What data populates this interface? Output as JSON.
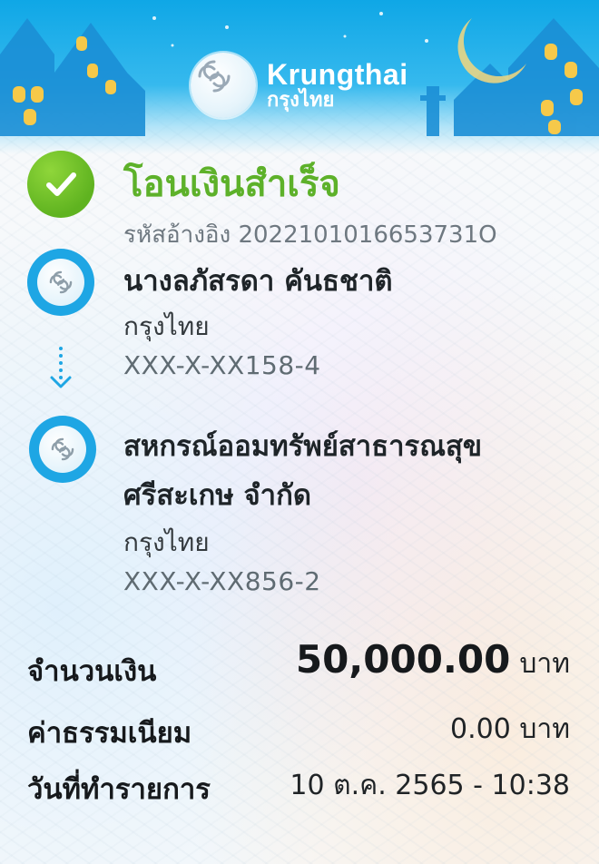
{
  "brand": {
    "name_en": "Krungthai",
    "name_th": "กรุงไทย"
  },
  "status": {
    "title": "โอนเงินสำเร็จ",
    "reference_label": "รหัสอ้างอิง",
    "reference_code": "2022101016653731O"
  },
  "sender": {
    "name": "นางลภัสรดา คันธชาติ",
    "bank": "กรุงไทย",
    "account": "XXX-X-XX158-4"
  },
  "recipient": {
    "name_line1": "สหกรณ์ออมทรัพย์สาธารณสุข",
    "name_line2": "ศรีสะเกษ จำกัด",
    "bank": "กรุงไทย",
    "account": "XXX-X-XX856-2"
  },
  "details": {
    "amount_label": "จำนวนเงิน",
    "amount_value": "50,000.00",
    "amount_unit": "บาท",
    "fee_label": "ค่าธรรมเนียม",
    "fee_value": "0.00 บาท",
    "date_label": "วันที่ทำรายการ",
    "date_value": "10 ต.ค. 2565 - 10:38"
  },
  "colors": {
    "brand_blue": "#1ea6e4",
    "success_green": "#5db12a"
  },
  "icons": {
    "status": "check-circle-icon",
    "bank": "krungthai-logo-icon",
    "transfer": "arrow-down-dotted-icon"
  }
}
